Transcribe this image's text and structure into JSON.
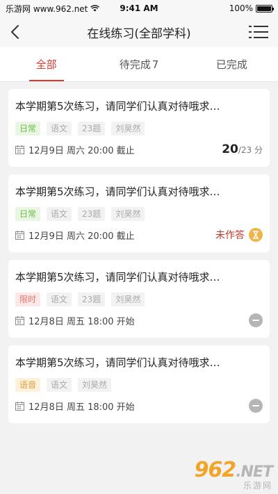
{
  "status_bar": {
    "left_text": "乐游网 www.962.net",
    "time": "9:41 AM",
    "battery": "100%",
    "battery_level": 1.0
  },
  "nav": {
    "title": "在线练习(全部学科)",
    "back_icon": "chevron-left-icon",
    "menu_icon": "menu-list-icon"
  },
  "tabs": [
    {
      "label": "全部",
      "count": "",
      "active": true
    },
    {
      "label": "待完成",
      "count": "7",
      "active": false
    },
    {
      "label": "已完成",
      "count": "",
      "active": false
    }
  ],
  "cards": [
    {
      "title": "本学期第5次练习，请同学们认真对待哦求…",
      "tags": [
        {
          "text": "日常",
          "style": "green"
        },
        {
          "text": "语文",
          "style": "gray"
        },
        {
          "text": "23题",
          "style": "gray"
        },
        {
          "text": "刘昊然",
          "style": "gray"
        }
      ],
      "date": "12月9日 周六 20:00 截止",
      "score": "20",
      "score_total": "/23 分"
    },
    {
      "title": "本学期第5次练习，请同学们认真对待哦求…",
      "tags": [
        {
          "text": "日常",
          "style": "green"
        },
        {
          "text": "语文",
          "style": "gray"
        },
        {
          "text": "23题",
          "style": "gray"
        },
        {
          "text": "刘昊然",
          "style": "gray"
        }
      ],
      "date": "12月9日 周六 20:00 截止",
      "status": "未作答"
    },
    {
      "title": "本学期第5次练习，请同学们认真对待哦求…",
      "tags": [
        {
          "text": "限时",
          "style": "red"
        },
        {
          "text": "语文",
          "style": "gray"
        },
        {
          "text": "23题",
          "style": "gray"
        },
        {
          "text": "刘昊然",
          "style": "gray"
        }
      ],
      "date": "12月8日 周五 18:00 开始"
    },
    {
      "title": "本学期第5次练习，请同学们认真对待哦求…",
      "tags": [
        {
          "text": "语音",
          "style": "orange"
        },
        {
          "text": "语文",
          "style": "gray"
        },
        {
          "text": "刘昊然",
          "style": "gray"
        }
      ],
      "date": "12月8日 周五 18:00 开始"
    }
  ],
  "watermark": {
    "brand_num": "962",
    "brand_suffix": ".NET",
    "brand_cn": "乐游网"
  },
  "colors": {
    "accent": "#d83b2e",
    "tag_green": "#6dbb4a",
    "tag_red": "#e57373",
    "tag_orange": "#e0a03a"
  }
}
